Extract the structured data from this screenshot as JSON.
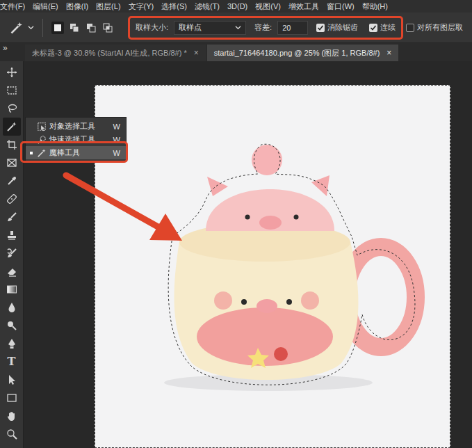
{
  "menu": {
    "items": [
      "文件(F)",
      "编辑(E)",
      "图像(I)",
      "图层(L)",
      "文字(Y)",
      "选择(S)",
      "滤镜(T)",
      "3D(D)",
      "视图(V)",
      "增效工具",
      "窗口(W)",
      "帮助(H)"
    ]
  },
  "options": {
    "selection_modes": [
      {
        "kind": "new",
        "selected": true
      },
      {
        "kind": "add",
        "selected": false
      },
      {
        "kind": "subtract",
        "selected": false
      },
      {
        "kind": "intersect",
        "selected": false
      }
    ],
    "sample_size": {
      "label": "取样大小:",
      "value": "取样点"
    },
    "tolerance": {
      "label": "容差:",
      "value": "20"
    },
    "checkboxes": [
      {
        "label": "消除锯齿",
        "checked": true
      },
      {
        "label": "连续",
        "checked": true
      },
      {
        "label": "对所有图层取",
        "checked": false
      }
    ]
  },
  "panel_toggle": "»",
  "tabs": [
    {
      "label": "未标题-3 @ 30.8% (StartAI AI生成, RGB/8#) *",
      "close": "×",
      "selected": false
    },
    {
      "label": "startai_716464180.png @ 25% (图层 1, RGB/8#)",
      "close": "×",
      "selected": true
    }
  ],
  "toolbar": {
    "tools": [
      {
        "kind": "move",
        "selected": false
      },
      {
        "kind": "marquee",
        "selected": false
      },
      {
        "kind": "lasso",
        "selected": false
      },
      {
        "kind": "wand",
        "selected": true
      },
      {
        "kind": "crop",
        "selected": false
      },
      {
        "kind": "frame",
        "selected": false
      },
      {
        "kind": "eyedropper",
        "selected": false
      },
      {
        "kind": "healing",
        "selected": false
      },
      {
        "kind": "brush",
        "selected": false
      },
      {
        "kind": "stamp",
        "selected": false
      },
      {
        "kind": "history",
        "selected": false
      },
      {
        "kind": "eraser",
        "selected": false
      },
      {
        "kind": "gradient",
        "selected": false
      },
      {
        "kind": "blur",
        "selected": false
      },
      {
        "kind": "dodge",
        "selected": false
      },
      {
        "kind": "pen",
        "selected": false
      },
      {
        "kind": "type",
        "glyph": "T",
        "selected": false
      },
      {
        "kind": "pathselect",
        "selected": false
      },
      {
        "kind": "rectangle",
        "selected": false
      },
      {
        "kind": "hand",
        "selected": false
      },
      {
        "kind": "zoom",
        "selected": false
      }
    ]
  },
  "tool_flyout": {
    "items": [
      {
        "label": "对象选择工具",
        "shortcut": "W",
        "selected": false
      },
      {
        "label": "快速选择工具",
        "shortcut": "W",
        "selected": false
      },
      {
        "label": "魔棒工具",
        "shortcut": "W",
        "selected": true
      }
    ]
  }
}
